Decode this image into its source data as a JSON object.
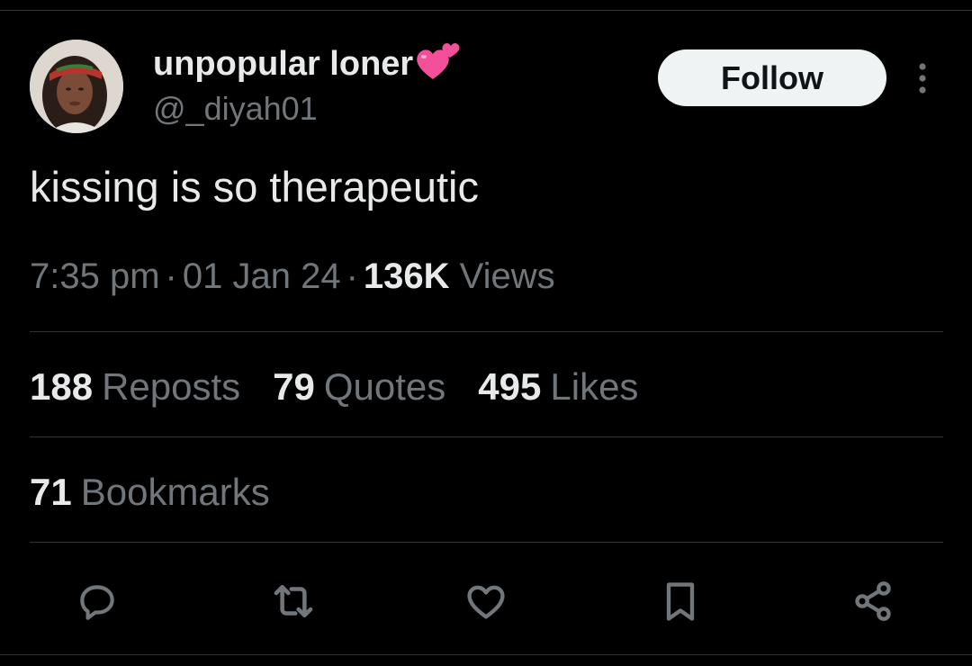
{
  "tweet": {
    "author": {
      "display_name": "unpopular loner",
      "name_emoji": "two-hearts-icon",
      "handle": "@_diyah01"
    },
    "follow_label": "Follow",
    "text": "kissing is so therapeutic",
    "meta": {
      "time": "7:35 pm",
      "date": "01 Jan 24",
      "views_count": "136K",
      "views_label": "Views",
      "separator": "·"
    },
    "stats": {
      "reposts_count": "188",
      "reposts_label": "Reposts",
      "quotes_count": "79",
      "quotes_label": "Quotes",
      "likes_count": "495",
      "likes_label": "Likes",
      "bookmarks_count": "71",
      "bookmarks_label": "Bookmarks"
    },
    "actions": [
      "reply-icon",
      "repost-icon",
      "like-icon",
      "bookmark-icon",
      "share-icon"
    ]
  },
  "colors": {
    "background": "#000000",
    "primary_text": "#e7e9ea",
    "secondary_text": "#71767b",
    "divider": "#2f3336",
    "follow_bg": "#eff3f4",
    "heart_pink": "#f4509a"
  }
}
